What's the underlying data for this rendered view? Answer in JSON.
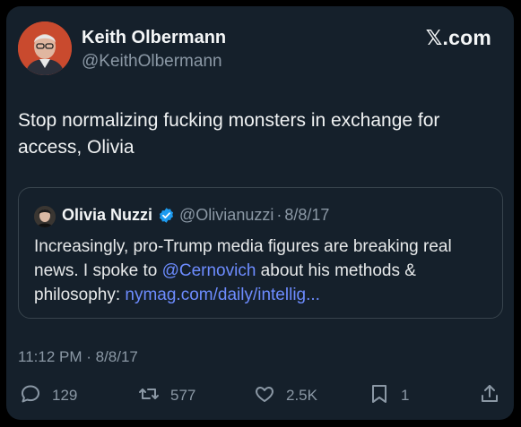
{
  "author": {
    "name": "Keith Olbermann",
    "handle": "@KeithOlbermann"
  },
  "brand": "𝕏.com",
  "tweet": {
    "text": "Stop normalizing fucking monsters in exchange for access, Olivia",
    "timestamp": "11:12 PM · 8/8/17"
  },
  "quote": {
    "name": "Olivia Nuzzi",
    "handle": "@Olivianuzzi",
    "separator": "·",
    "date": "8/8/17",
    "text_part1": "Increasingly, pro-Trump media figures are breaking real news. I spoke to ",
    "mention": "@Cernovich",
    "text_part2": " about his methods & philosophy: ",
    "link": "nymag.com/daily/intellig..."
  },
  "actions": {
    "replies": "129",
    "retweets": "577",
    "likes": "2.5K",
    "bookmarks": "1"
  },
  "colors": {
    "card_bg": "#15202b",
    "link": "#6d8cff",
    "verified": "#1d9bf0",
    "muted": "#8b98a5"
  },
  "icons": [
    "reply-icon",
    "retweet-icon",
    "like-icon",
    "bookmark-icon",
    "share-icon",
    "verified-badge-icon"
  ]
}
